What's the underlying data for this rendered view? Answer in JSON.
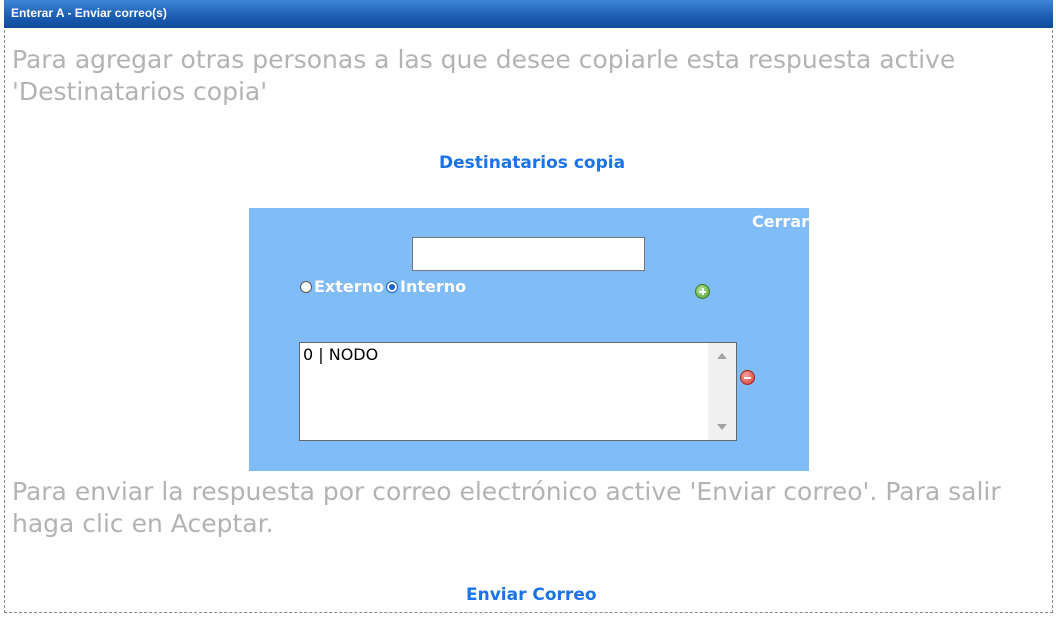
{
  "window": {
    "title": "Enterar A - Enviar correo(s)"
  },
  "instructions": {
    "copy_hint": "Para agregar otras personas a las que desee copiarle esta respuesta active 'Destinatarios copia'",
    "send_hint": "Para enviar la respuesta por correo electrónico active 'Enviar correo'. Para salir haga clic en Aceptar."
  },
  "links": {
    "recipients_copy": "Destinatarios copia",
    "send_mail": "Enviar Correo"
  },
  "panel": {
    "close_label": "Cerrar",
    "recipient_input": {
      "value": ""
    },
    "radio": {
      "external_label": "Externo",
      "internal_label": "Interno",
      "selected": "Interno"
    },
    "recipients_list": [
      "0 | NODO"
    ]
  },
  "colors": {
    "title_bar": "#1d5fb4",
    "link": "#1a73e8",
    "panel_bg": "#80bcf7",
    "hint_text": "#b3b3b3"
  },
  "icons": {
    "add": "plus-circle-icon",
    "remove": "minus-circle-icon"
  }
}
